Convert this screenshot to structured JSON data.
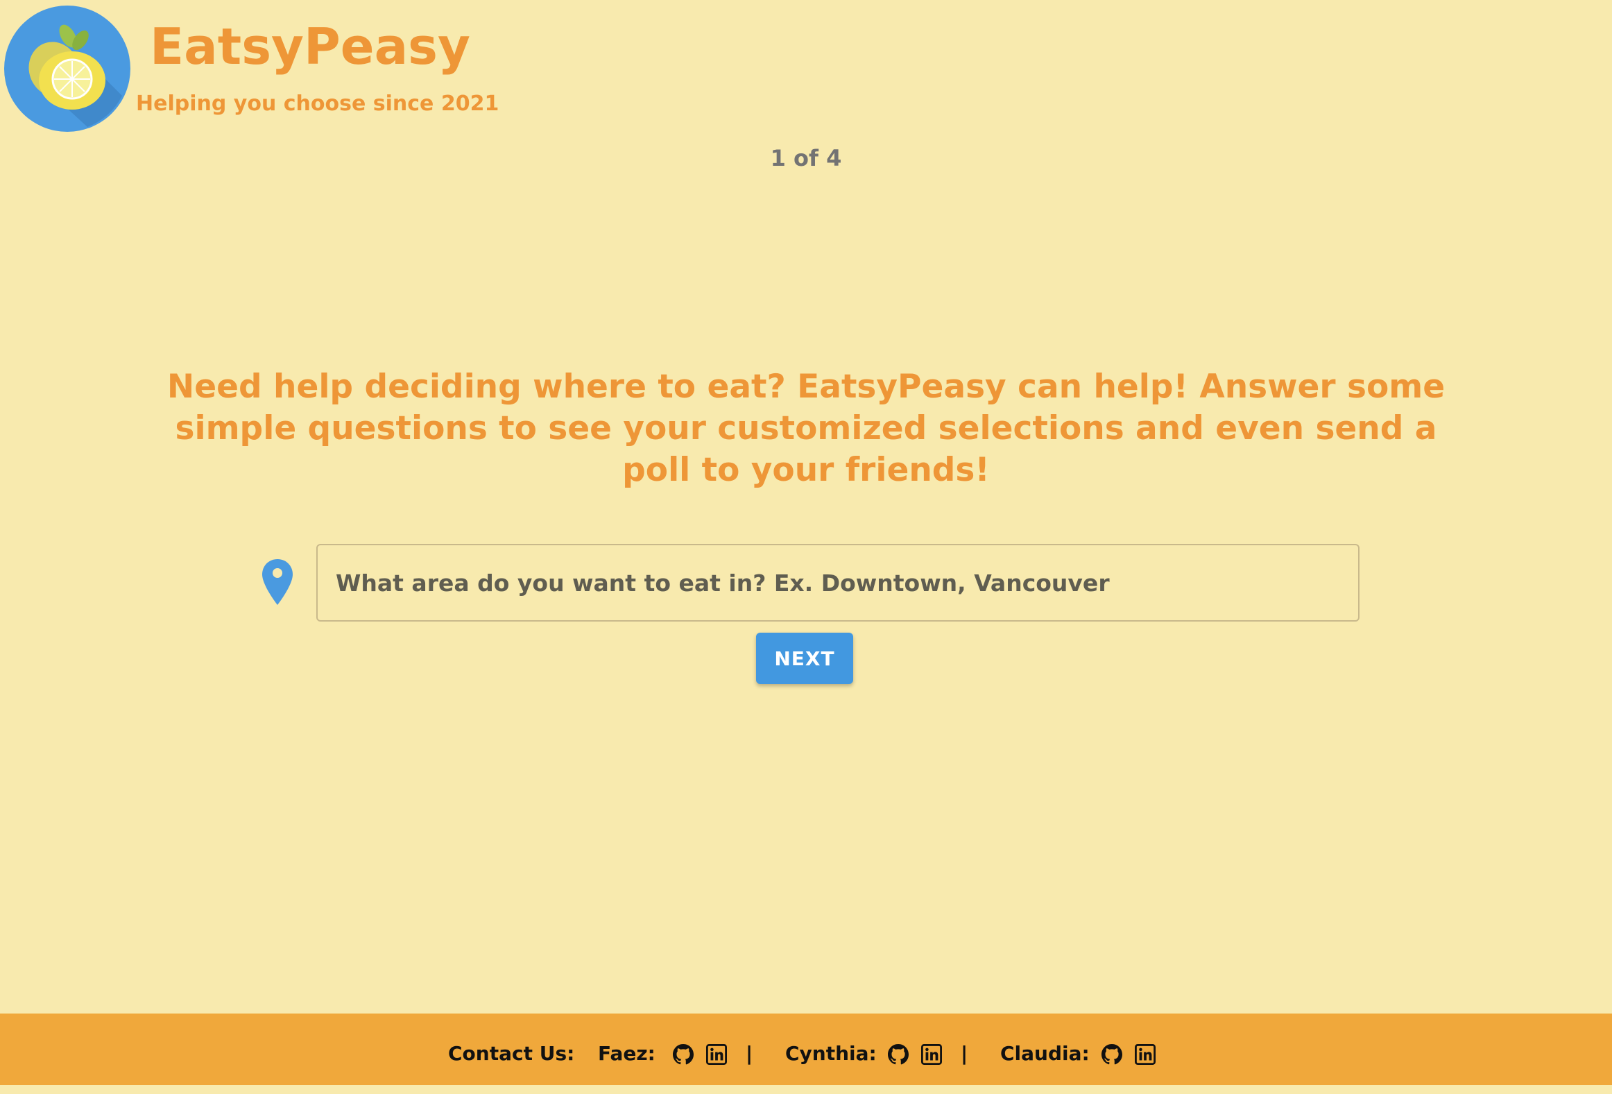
{
  "brand": {
    "name": "EatsyPeasy",
    "tagline": "Helping you choose since 2021"
  },
  "step": {
    "label": "1 of 4"
  },
  "intro": {
    "text": "Need help deciding where to eat? EatsyPeasy can help! Answer some simple questions to see your customized selections and even send a poll to your friends!"
  },
  "location": {
    "placeholder": "What area do you want to eat in? Ex. Downtown, Vancouver",
    "icon": "map-pin-icon"
  },
  "actions": {
    "next_label": "NEXT"
  },
  "footer": {
    "contact_label": "Contact Us:",
    "separator": "|",
    "people": [
      {
        "name": "Faez:",
        "icons": [
          "github-icon",
          "linkedin-icon"
        ]
      },
      {
        "name": "Cynthia:",
        "icons": [
          "github-icon",
          "linkedin-icon"
        ]
      },
      {
        "name": "Claudia:",
        "icons": [
          "github-icon",
          "linkedin-icon"
        ]
      }
    ]
  },
  "colors": {
    "background": "#f8eaae",
    "brand_orange": "#ee9637",
    "accent_blue": "#4298e0",
    "footer_bg": "#f0a83b",
    "step_text": "#737373"
  }
}
